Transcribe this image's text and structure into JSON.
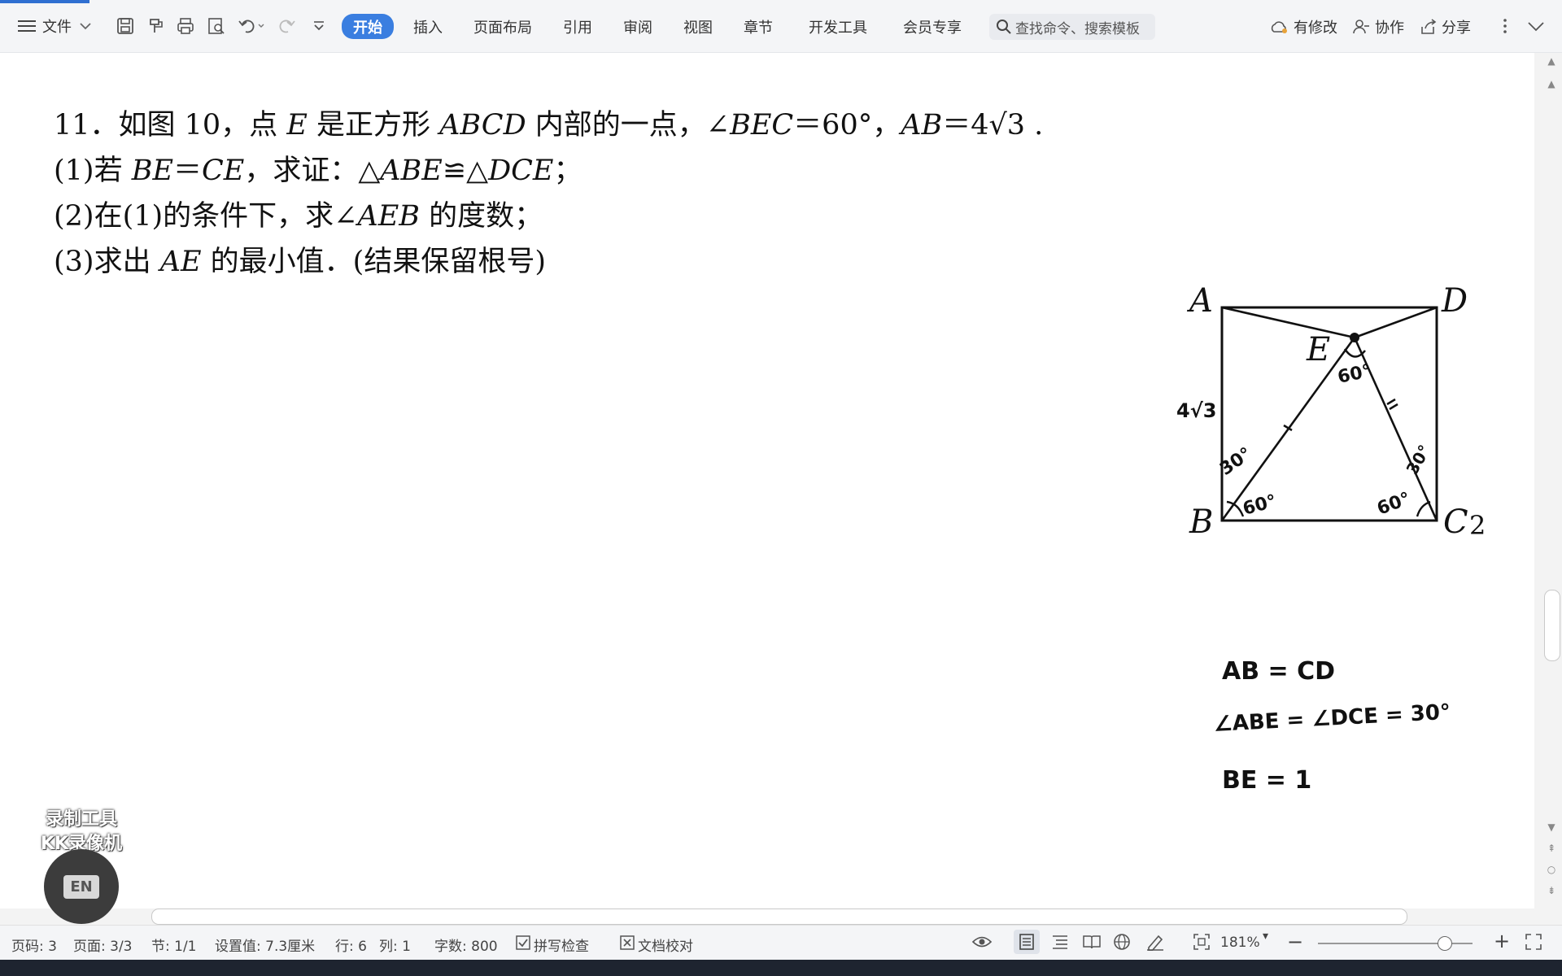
{
  "toolbar": {
    "file_menu": "文件",
    "tabs": [
      {
        "label": "开始",
        "active": true
      },
      {
        "label": "插入"
      },
      {
        "label": "页面布局"
      },
      {
        "label": "引用"
      },
      {
        "label": "审阅"
      },
      {
        "label": "视图"
      },
      {
        "label": "章节"
      },
      {
        "label": "开发工具"
      },
      {
        "label": "会员专享"
      }
    ],
    "search_placeholder": "查找命令、搜索模板",
    "has_changes": "有修改",
    "collaborate": "协作",
    "share": "分享",
    "accent_color": "#3a7ee0"
  },
  "document": {
    "q_num": "11．如图 10，点 ",
    "q_E": "E",
    "q_mid": " 是正方形 ",
    "q_ABCD": "ABCD",
    "q_mid2": " 内部的一点，∠",
    "q_BEC": "BEC",
    "q_eq": "＝60°，",
    "q_AB": "AB",
    "q_val": "＝4√3 .",
    "p1_a": "(1)若 ",
    "p1_be": "BE",
    "p1_eq": "＝",
    "p1_ce": "CE",
    "p1_b": "，求证：△",
    "p1_abe": "ABE",
    "p1_cong": "≌△",
    "p1_dce": "DCE",
    "p1_end": "；",
    "p2_a": "(2)在(1)的条件下，求∠",
    "p2_aeb": "AEB",
    "p2_b": " 的度数；",
    "p3_a": "(3)求出 ",
    "p3_ae": "AE",
    "p3_b": " 的最小值．(结果保留根号)"
  },
  "figure": {
    "label_A": "A",
    "label_B": "B",
    "label_C": "C",
    "label_D": "D",
    "label_E": "E",
    "label_2": "2",
    "hand_side": "4√3",
    "hand_apex": "60°",
    "hand_b30": "30°",
    "hand_b60": "60°",
    "hand_c30": "30°",
    "hand_c60": "60°",
    "note1": "AB = CD",
    "note2": "∠ABE = ∠DCE = 30°",
    "note3": "BE = 1"
  },
  "status": {
    "page_code": "页码: 3",
    "pages": "页面: 3/3",
    "section": "节: 1/1",
    "setting": "设置值: 7.3厘米",
    "row": "行: 6",
    "col": "列: 1",
    "words": "字数: 800",
    "spell": "拼写检查",
    "proof": "文档校对",
    "zoom": "181%",
    "zoom_fraction": 0.82
  },
  "overlay": {
    "watermark_line1": "录制工具",
    "watermark_line2": "KK录像机",
    "ime_label": "EN"
  }
}
